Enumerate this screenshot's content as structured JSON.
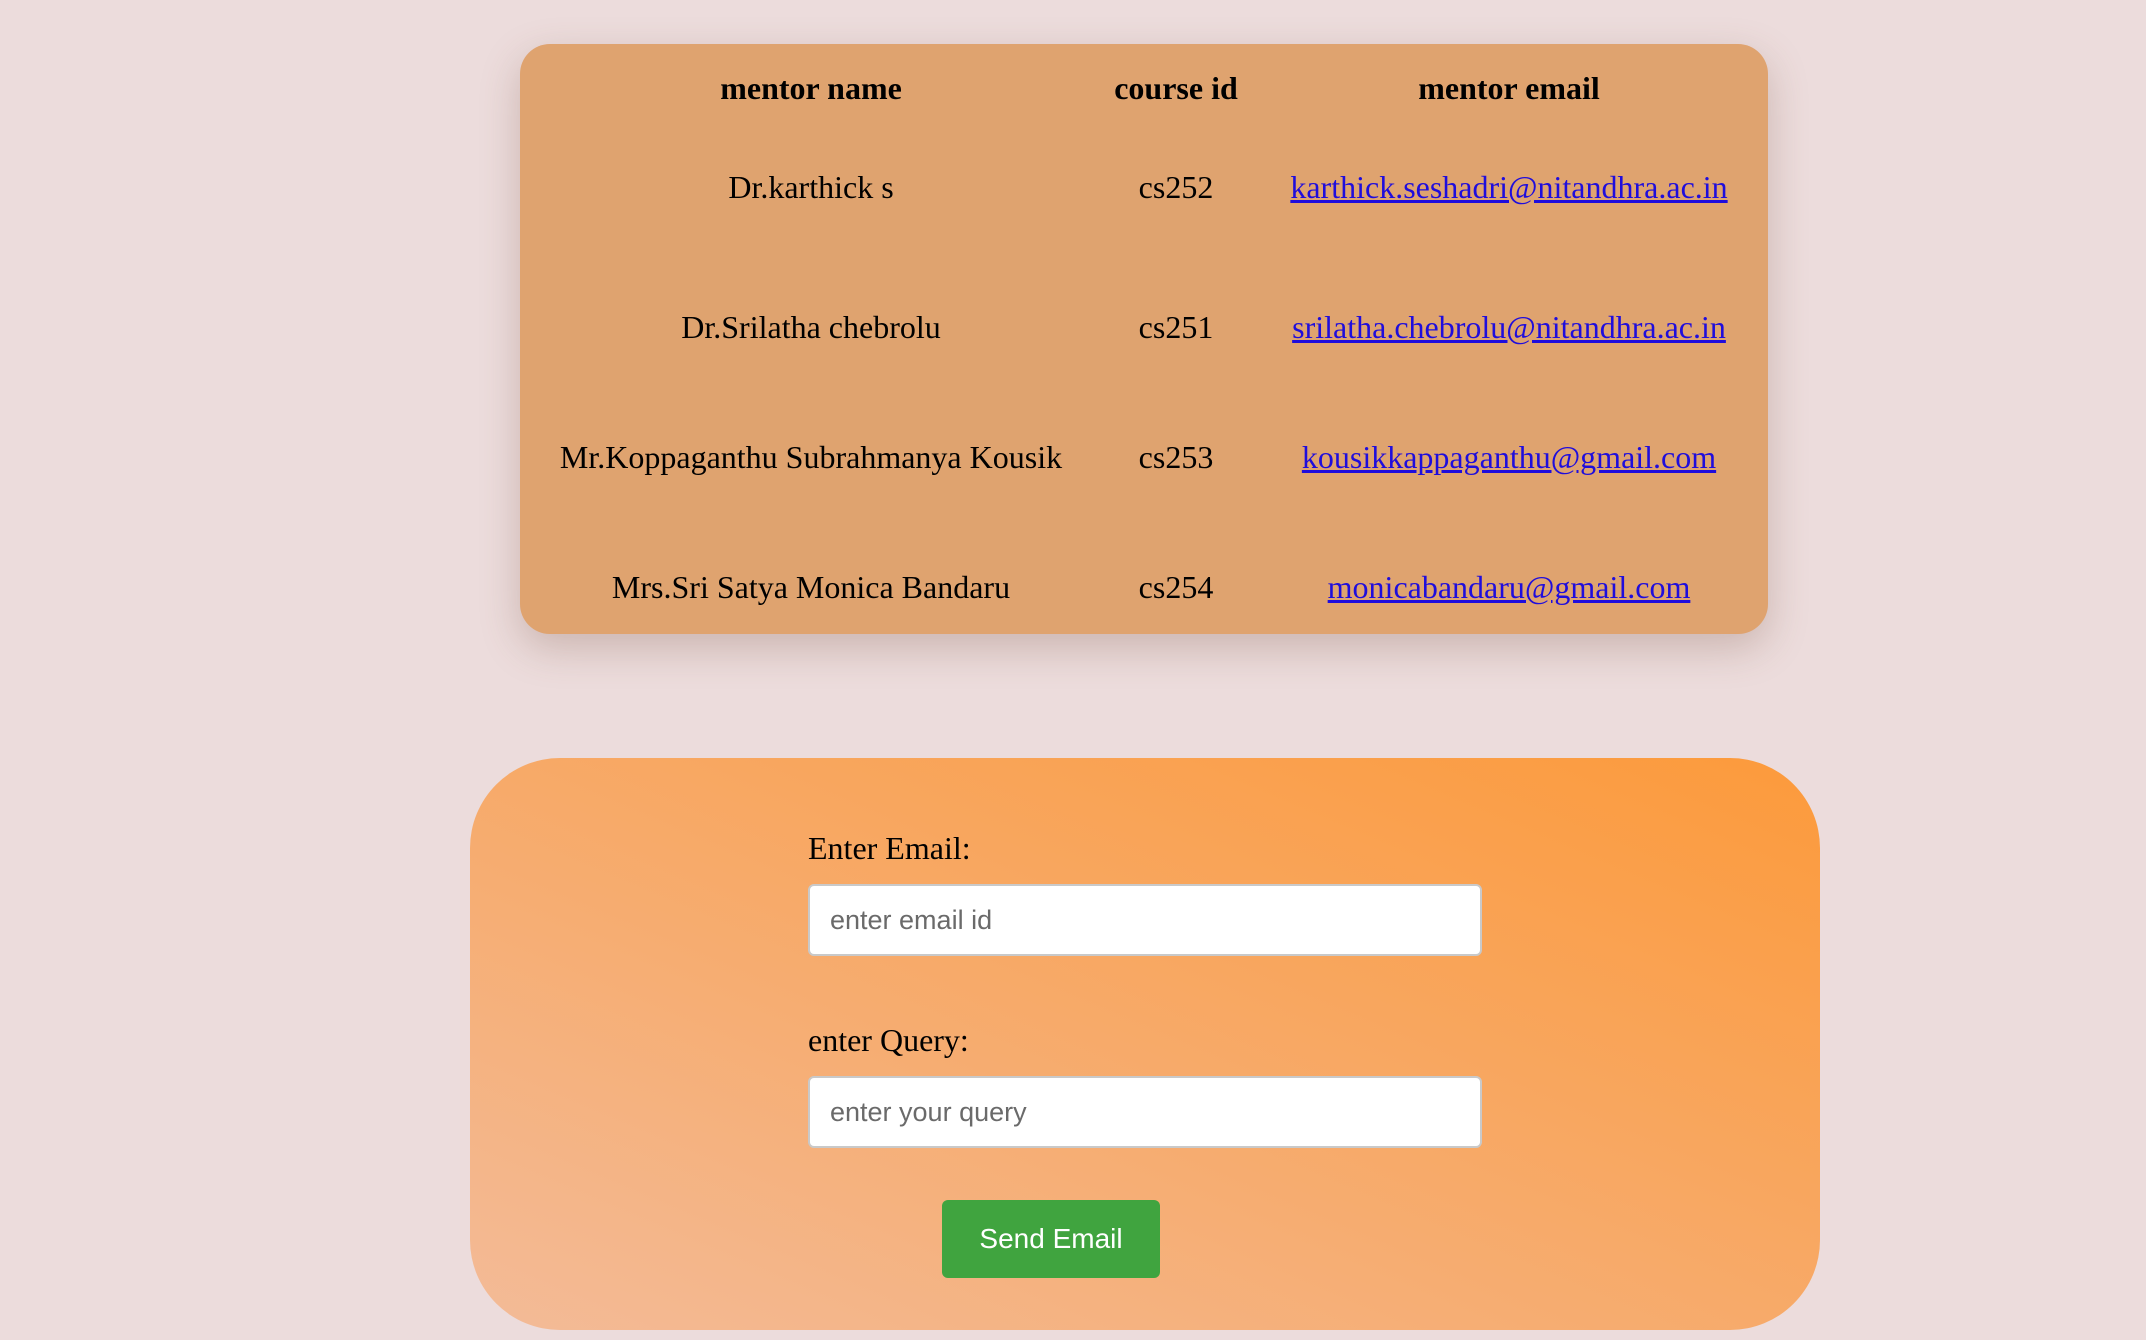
{
  "mentor_table": {
    "headers": {
      "name": "mentor name",
      "course": "course id",
      "email": "mentor email"
    },
    "rows": [
      {
        "name": "Dr.karthick s",
        "course": "cs252",
        "email": "karthick.seshadri@nitandhra.ac.in"
      },
      {
        "name": "Dr.Srilatha chebrolu",
        "course": "cs251",
        "email": "srilatha.chebrolu@nitandhra.ac.in"
      },
      {
        "name": "Mr.Koppaganthu Subrahmanya Kousik",
        "course": "cs253",
        "email": "kousikkappaganthu@gmail.com"
      },
      {
        "name": "Mrs.Sri Satya Monica Bandaru",
        "course": "cs254",
        "email": "monicabandaru@gmail.com"
      }
    ]
  },
  "form": {
    "email_label": "Enter Email:",
    "email_value": "",
    "email_placeholder": "enter email id",
    "query_label": "enter Query:",
    "query_value": "",
    "query_placeholder": "enter your query",
    "send_label": "Send Email"
  },
  "colors": {
    "page_background": "#ecdcdc",
    "table_card": "#dfa36f",
    "form_gradient_start": "#f3bb98",
    "form_gradient_end": "#fc9a3b",
    "button": "#40a43f",
    "link": "#1f0ddc"
  }
}
